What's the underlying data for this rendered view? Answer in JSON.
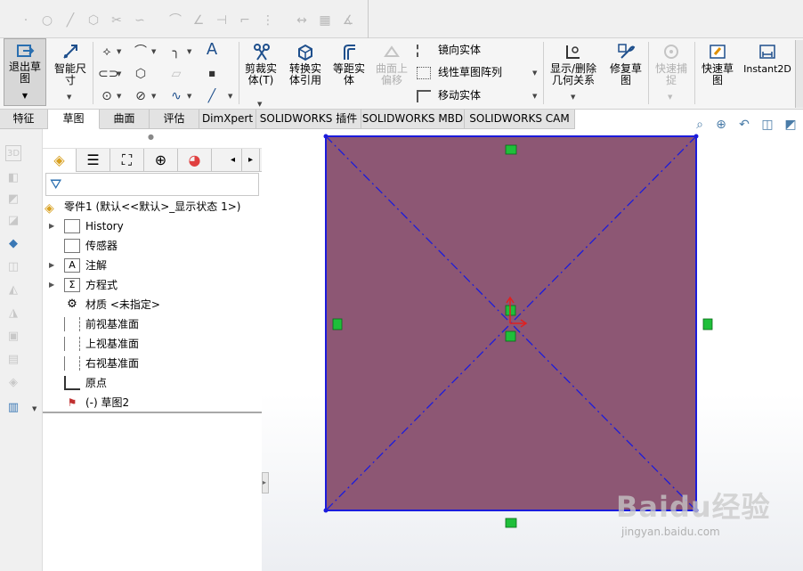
{
  "ribbon": {
    "exit_sketch": "退出草图",
    "smart_dim": "智能尺寸",
    "trim": "剪裁实体(T)",
    "convert": "转换实体引用",
    "offset": "等距实体",
    "surface_offset": "曲面上偏移",
    "mirror": "镜向实体",
    "linear_pattern": "线性草图阵列",
    "move": "移动实体",
    "show_relations": "显示/删除几何关系",
    "repair": "修复草图",
    "quick_snap": "快速捕捉",
    "rapid_sketch": "快速草图",
    "instant2d": "Instant2D"
  },
  "tabs": [
    {
      "label": "特征"
    },
    {
      "label": "草图"
    },
    {
      "label": "曲面"
    },
    {
      "label": "评估"
    },
    {
      "label": "DimXpert"
    },
    {
      "label": "SOLIDWORKS 插件"
    },
    {
      "label": "SOLIDWORKS MBD"
    },
    {
      "label": "SOLIDWORKS CAM"
    }
  ],
  "active_tab": "草图",
  "tree": {
    "root": "零件1  (默认<<默认>_显示状态 1>)",
    "items": [
      {
        "label": "History",
        "expand": true
      },
      {
        "label": "传感器",
        "expand": false
      },
      {
        "label": "注解",
        "expand": true
      },
      {
        "label": "方程式",
        "expand": true
      },
      {
        "label": "材质 <未指定>",
        "expand": false
      },
      {
        "label": "前视基准面",
        "expand": false
      },
      {
        "label": "上视基准面",
        "expand": false
      },
      {
        "label": "右视基准面",
        "expand": false
      },
      {
        "label": "原点",
        "expand": false
      },
      {
        "label": "(-) 草图2",
        "expand": false
      }
    ]
  },
  "colors": {
    "sketch_fill": "#8d5774",
    "sketch_line": "#1c1cdc",
    "relation_marker": "#1fbf3a"
  },
  "watermark": {
    "brand": "Baidu经验",
    "url": "jingyan.baidu.com"
  }
}
